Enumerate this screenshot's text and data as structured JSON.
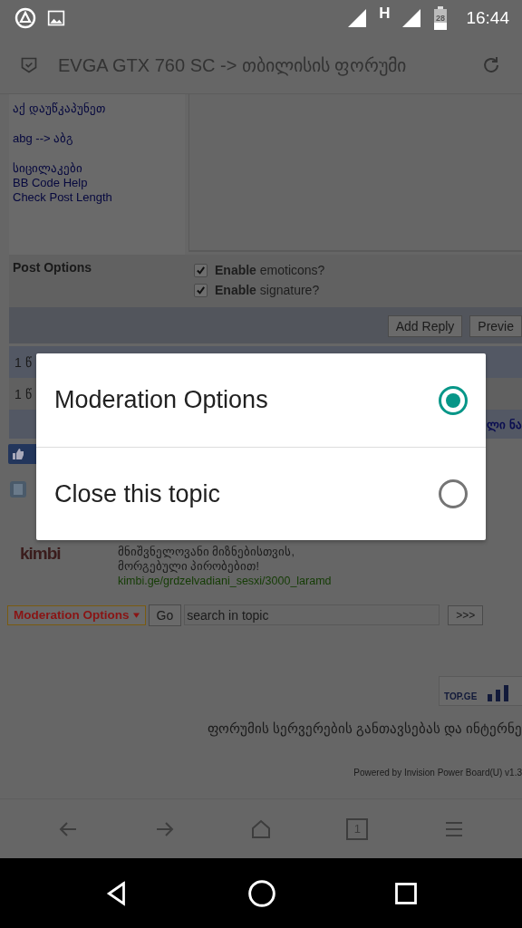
{
  "status_bar": {
    "network": "H",
    "battery": "28",
    "time": "16:44"
  },
  "browser": {
    "title": "EVGA GTX 760 SC -> თბილისის ფორუმი"
  },
  "page": {
    "side_links": [
      "აქ დაუწკაპუნეთ",
      "abg --> აბგ",
      "სიცილაკები",
      "BB Code Help",
      "Check Post Length"
    ],
    "post_options": {
      "label": "Post Options",
      "options": [
        {
          "text": "**Enable** emoticons?",
          "checked": true
        },
        {
          "text": "**Enable** signature?",
          "checked": true
        }
      ]
    },
    "buttons": [
      "Add Reply",
      "Previe"
    ],
    "rows": [
      "1 წ",
      "1 წ",
      "ლი ნა"
    ],
    "ad": {
      "logo": "kimbi",
      "lines": [
        "მნიშვნელოვანი მიზნებისთვის,",
        "მორგებული პირობებით!"
      ],
      "link": "kimbi.ge/grdzelvadiani_sesxi/3000_laramd"
    },
    "moderation": {
      "select": "Moderation Options",
      "go": "Go",
      "search": "search in topic",
      "next": ">>>"
    },
    "badge": "TOP.GE",
    "footer": "ფორუმის სერვერების განთავსებას და ინტერნე",
    "powered": "Powered by Invision Power Board(U) v1.3"
  },
  "tab_count": "1",
  "dialog": {
    "options": [
      {
        "label": "Moderation Options",
        "selected": true
      },
      {
        "label": "Close this topic",
        "selected": false
      }
    ]
  }
}
